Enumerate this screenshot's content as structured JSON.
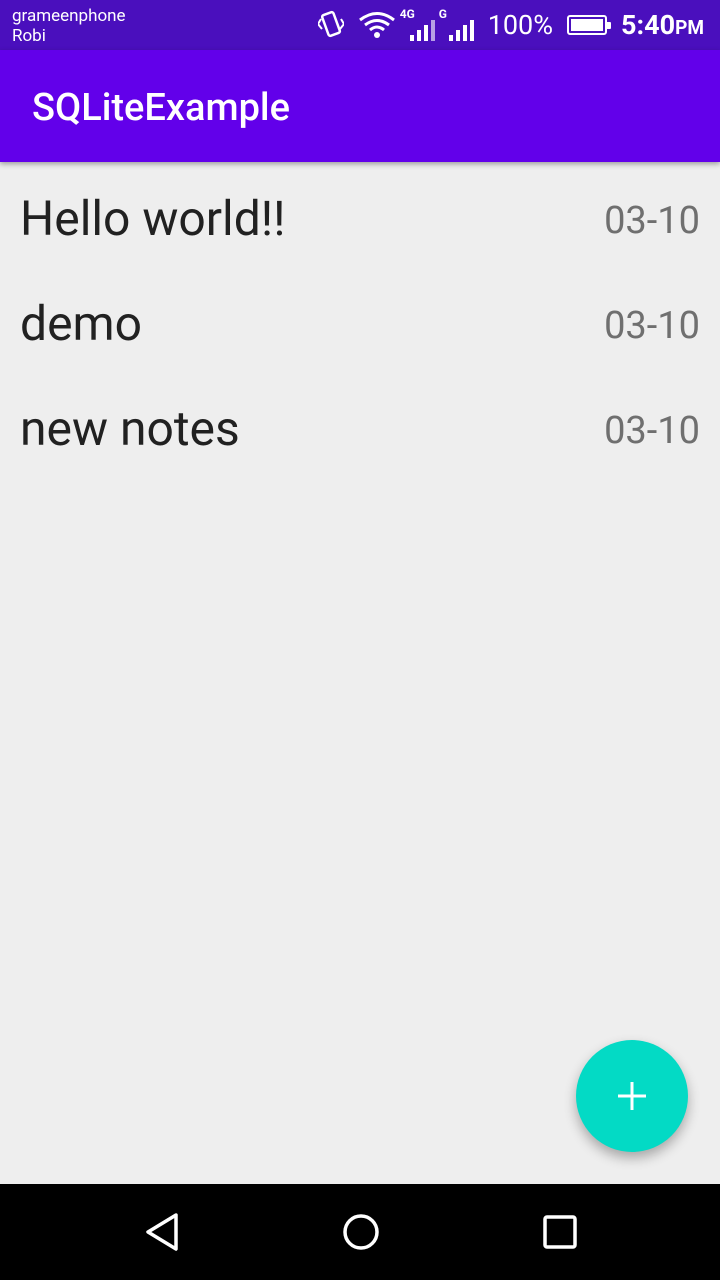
{
  "status_bar": {
    "carrier_1": "grameenphone",
    "carrier_2": "Robi",
    "network_1": "4G",
    "network_2": "G",
    "battery": "100%",
    "time": "5:40",
    "ampm": "PM",
    "icons": [
      "vibrate-icon",
      "wifi-icon",
      "signal-4g-icon",
      "signal-g-icon",
      "battery-icon"
    ]
  },
  "app_bar": {
    "title": "SQLiteExample",
    "color": "#6200ea"
  },
  "notes": [
    {
      "title": "Hello world!!",
      "date": "03-10"
    },
    {
      "title": "demo",
      "date": "03-10"
    },
    {
      "title": "new notes",
      "date": "03-10"
    }
  ],
  "fab": {
    "icon": "plus-icon",
    "color": "#03dac5"
  },
  "nav_bar": {
    "icons": [
      "back-icon",
      "home-icon",
      "recents-icon"
    ]
  }
}
